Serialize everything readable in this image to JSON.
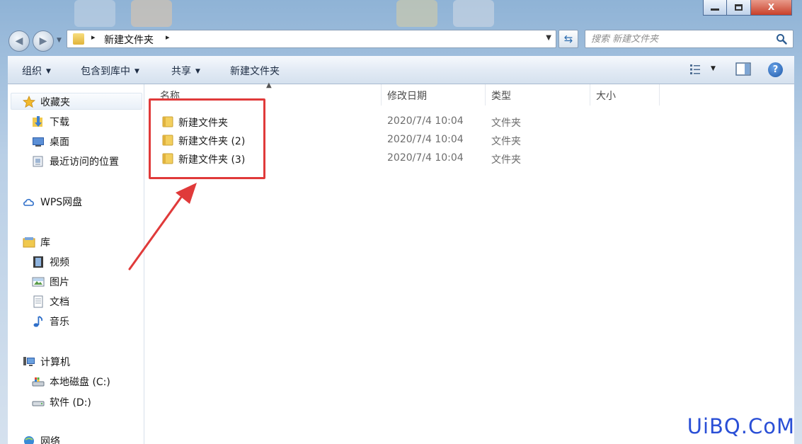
{
  "window": {
    "minimize_label": "",
    "maximize_label": "",
    "close_label": "X"
  },
  "address_bar": {
    "path": "新建文件夹",
    "separator": "▸",
    "refresh_icon": "refresh-icon"
  },
  "search": {
    "placeholder": "搜索 新建文件夹"
  },
  "toolbar": {
    "organize": "组织",
    "include_in_library": "包含到库中",
    "share": "共享",
    "new_folder": "新建文件夹",
    "dropdown_glyph": "▼"
  },
  "sidebar": {
    "favorites": {
      "label": "收藏夹",
      "items": [
        {
          "label": "下载",
          "icon": "downloads-folder-icon"
        },
        {
          "label": "桌面",
          "icon": "desktop-icon"
        },
        {
          "label": "最近访问的位置",
          "icon": "recent-places-icon"
        }
      ]
    },
    "wps": {
      "label": "WPS网盘",
      "icon": "cloud-icon"
    },
    "libraries": {
      "label": "库",
      "items": [
        {
          "label": "视频",
          "icon": "video-library-icon"
        },
        {
          "label": "图片",
          "icon": "pictures-library-icon"
        },
        {
          "label": "文档",
          "icon": "documents-library-icon"
        },
        {
          "label": "音乐",
          "icon": "music-library-icon"
        }
      ]
    },
    "computer": {
      "label": "计算机",
      "items": [
        {
          "label": "本地磁盘 (C:)",
          "icon": "local-disk-icon"
        },
        {
          "label": "软件 (D:)",
          "icon": "drive-icon"
        }
      ]
    },
    "network": {
      "label": "网络",
      "icon": "network-icon"
    }
  },
  "file_list": {
    "columns": [
      "名称",
      "修改日期",
      "类型",
      "大小"
    ],
    "rows": [
      {
        "name": "新建文件夹",
        "modified": "2020/7/4 10:04",
        "type": "文件夹",
        "size": ""
      },
      {
        "name": "新建文件夹 (2)",
        "modified": "2020/7/4 10:04",
        "type": "文件夹",
        "size": ""
      },
      {
        "name": "新建文件夹 (3)",
        "modified": "2020/7/4 10:04",
        "type": "文件夹",
        "size": ""
      }
    ]
  },
  "annotation": {
    "highlight_color": "#e03a3a"
  },
  "watermark": "UiBQ.CoM"
}
